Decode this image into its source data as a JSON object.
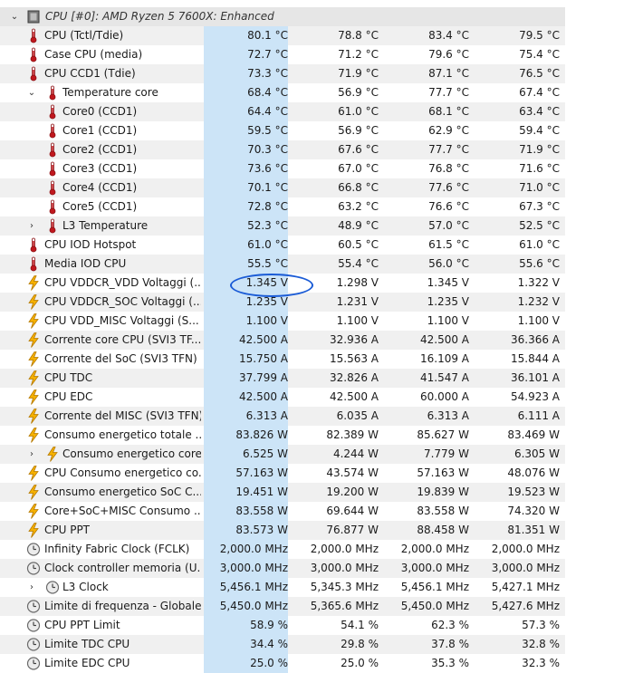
{
  "header": {
    "expander": "⌄",
    "title": "CPU [#0]: AMD Ryzen 5 7600X: Enhanced"
  },
  "rows": [
    {
      "level": 1,
      "icon": "thermometer-icon",
      "expander": "",
      "label": "CPU (Tctl/Tdie)",
      "values": [
        "80.1 °C",
        "78.8 °C",
        "83.4 °C",
        "79.5 °C"
      ]
    },
    {
      "level": 1,
      "icon": "thermometer-icon",
      "expander": "",
      "label": "Case CPU (media)",
      "values": [
        "72.7 °C",
        "71.2 °C",
        "79.6 °C",
        "75.4 °C"
      ]
    },
    {
      "level": 1,
      "icon": "thermometer-icon",
      "expander": "",
      "label": "CPU CCD1 (Tdie)",
      "values": [
        "73.3 °C",
        "71.9 °C",
        "87.1 °C",
        "76.5 °C"
      ]
    },
    {
      "level": 2,
      "icon": "thermometer-icon",
      "expander": "⌄",
      "label": "Temperature core",
      "values": [
        "68.4 °C",
        "56.9 °C",
        "77.7 °C",
        "67.4 °C"
      ]
    },
    {
      "level": 3,
      "icon": "thermometer-icon",
      "expander": "",
      "label": "Core0 (CCD1)",
      "values": [
        "64.4 °C",
        "61.0 °C",
        "68.1 °C",
        "63.4 °C"
      ]
    },
    {
      "level": 3,
      "icon": "thermometer-icon",
      "expander": "",
      "label": "Core1 (CCD1)",
      "values": [
        "59.5 °C",
        "56.9 °C",
        "62.9 °C",
        "59.4 °C"
      ]
    },
    {
      "level": 3,
      "icon": "thermometer-icon",
      "expander": "",
      "label": "Core2 (CCD1)",
      "values": [
        "70.3 °C",
        "67.6 °C",
        "77.7 °C",
        "71.9 °C"
      ]
    },
    {
      "level": 3,
      "icon": "thermometer-icon",
      "expander": "",
      "label": "Core3 (CCD1)",
      "values": [
        "73.6 °C",
        "67.0 °C",
        "76.8 °C",
        "71.6 °C"
      ]
    },
    {
      "level": 3,
      "icon": "thermometer-icon",
      "expander": "",
      "label": "Core4 (CCD1)",
      "values": [
        "70.1 °C",
        "66.8 °C",
        "77.6 °C",
        "71.0 °C"
      ]
    },
    {
      "level": 3,
      "icon": "thermometer-icon",
      "expander": "",
      "label": "Core5 (CCD1)",
      "values": [
        "72.8 °C",
        "63.2 °C",
        "76.6 °C",
        "67.3 °C"
      ]
    },
    {
      "level": 2,
      "icon": "thermometer-icon",
      "expander": "›",
      "label": "L3 Temperature",
      "values": [
        "52.3 °C",
        "48.9 °C",
        "57.0 °C",
        "52.5 °C"
      ]
    },
    {
      "level": 1,
      "icon": "thermometer-icon",
      "expander": "",
      "label": "CPU IOD Hotspot",
      "values": [
        "61.0 °C",
        "60.5 °C",
        "61.5 °C",
        "61.0 °C"
      ]
    },
    {
      "level": 1,
      "icon": "thermometer-icon",
      "expander": "",
      "label": "Media IOD CPU",
      "values": [
        "55.5 °C",
        "55.4 °C",
        "56.0 °C",
        "55.6 °C"
      ]
    },
    {
      "level": 1,
      "icon": "lightning-icon",
      "expander": "",
      "label": "CPU VDDCR_VDD Voltaggi (...",
      "values": [
        "1.345 V",
        "1.298 V",
        "1.345 V",
        "1.322 V"
      ]
    },
    {
      "level": 1,
      "icon": "lightning-icon",
      "expander": "",
      "label": "CPU VDDCR_SOC Voltaggi (...",
      "values": [
        "1.235 V",
        "1.231 V",
        "1.235 V",
        "1.232 V"
      ]
    },
    {
      "level": 1,
      "icon": "lightning-icon",
      "expander": "",
      "label": "CPU VDD_MISC Voltaggi (S...",
      "values": [
        "1.100 V",
        "1.100 V",
        "1.100 V",
        "1.100 V"
      ]
    },
    {
      "level": 1,
      "icon": "lightning-icon",
      "expander": "",
      "label": "Corrente core CPU (SVI3 TF...",
      "values": [
        "42.500 A",
        "32.936 A",
        "42.500 A",
        "36.366 A"
      ]
    },
    {
      "level": 1,
      "icon": "lightning-icon",
      "expander": "",
      "label": "Corrente del SoC (SVI3 TFN)",
      "values": [
        "15.750 A",
        "15.563 A",
        "16.109 A",
        "15.844 A"
      ]
    },
    {
      "level": 1,
      "icon": "lightning-icon",
      "expander": "",
      "label": "CPU TDC",
      "values": [
        "37.799 A",
        "32.826 A",
        "41.547 A",
        "36.101 A"
      ]
    },
    {
      "level": 1,
      "icon": "lightning-icon",
      "expander": "",
      "label": "CPU EDC",
      "values": [
        "42.500 A",
        "42.500 A",
        "60.000 A",
        "54.923 A"
      ]
    },
    {
      "level": 1,
      "icon": "lightning-icon",
      "expander": "",
      "label": "Corrente del MISC (SVI3 TFN)",
      "values": [
        "6.313 A",
        "6.035 A",
        "6.313 A",
        "6.111 A"
      ]
    },
    {
      "level": 1,
      "icon": "lightning-icon",
      "expander": "",
      "label": "Consumo energetico totale ...",
      "values": [
        "83.826 W",
        "82.389 W",
        "85.627 W",
        "83.469 W"
      ]
    },
    {
      "level": 2,
      "icon": "lightning-icon",
      "expander": "›",
      "label": "Consumo energetico core",
      "values": [
        "6.525 W",
        "4.244 W",
        "7.779 W",
        "6.305 W"
      ]
    },
    {
      "level": 1,
      "icon": "lightning-icon",
      "expander": "",
      "label": "CPU Consumo energetico co...",
      "values": [
        "57.163 W",
        "43.574 W",
        "57.163 W",
        "48.076 W"
      ]
    },
    {
      "level": 1,
      "icon": "lightning-icon",
      "expander": "",
      "label": "Consumo energetico SoC C...",
      "values": [
        "19.451 W",
        "19.200 W",
        "19.839 W",
        "19.523 W"
      ]
    },
    {
      "level": 1,
      "icon": "lightning-icon",
      "expander": "",
      "label": "Core+SoC+MISC Consumo ...",
      "values": [
        "83.558 W",
        "69.644 W",
        "83.558 W",
        "74.320 W"
      ]
    },
    {
      "level": 1,
      "icon": "lightning-icon",
      "expander": "",
      "label": "CPU PPT",
      "values": [
        "83.573 W",
        "76.877 W",
        "88.458 W",
        "81.351 W"
      ]
    },
    {
      "level": 1,
      "icon": "clock-icon",
      "expander": "",
      "label": "Infinity Fabric Clock (FCLK)",
      "values": [
        "2,000.0 MHz",
        "2,000.0 MHz",
        "2,000.0 MHz",
        "2,000.0 MHz"
      ]
    },
    {
      "level": 1,
      "icon": "clock-icon",
      "expander": "",
      "label": "Clock controller memoria (U...",
      "values": [
        "3,000.0 MHz",
        "3,000.0 MHz",
        "3,000.0 MHz",
        "3,000.0 MHz"
      ]
    },
    {
      "level": 2,
      "icon": "clock-icon",
      "expander": "›",
      "label": "L3 Clock",
      "values": [
        "5,456.1 MHz",
        "5,345.3 MHz",
        "5,456.1 MHz",
        "5,427.1 MHz"
      ]
    },
    {
      "level": 1,
      "icon": "clock-icon",
      "expander": "",
      "label": "Limite di frequenza - Globale",
      "values": [
        "5,450.0 MHz",
        "5,365.6 MHz",
        "5,450.0 MHz",
        "5,427.6 MHz"
      ]
    },
    {
      "level": 1,
      "icon": "clock-icon",
      "expander": "",
      "label": "CPU PPT Limit",
      "values": [
        "58.9 %",
        "54.1 %",
        "62.3 %",
        "57.3 %"
      ]
    },
    {
      "level": 1,
      "icon": "clock-icon",
      "expander": "",
      "label": "Limite TDC CPU",
      "values": [
        "34.4 %",
        "29.8 %",
        "37.8 %",
        "32.8 %"
      ]
    },
    {
      "level": 1,
      "icon": "clock-icon",
      "expander": "",
      "label": "Limite EDC CPU",
      "values": [
        "25.0 %",
        "25.0 %",
        "35.3 %",
        "32.3 %"
      ]
    }
  ],
  "colors": {
    "current_column_bg": "#cce4f7",
    "annotation_oval": "#1a5bd6",
    "thermometer": "#c0181e",
    "lightning": "#f0a500"
  }
}
